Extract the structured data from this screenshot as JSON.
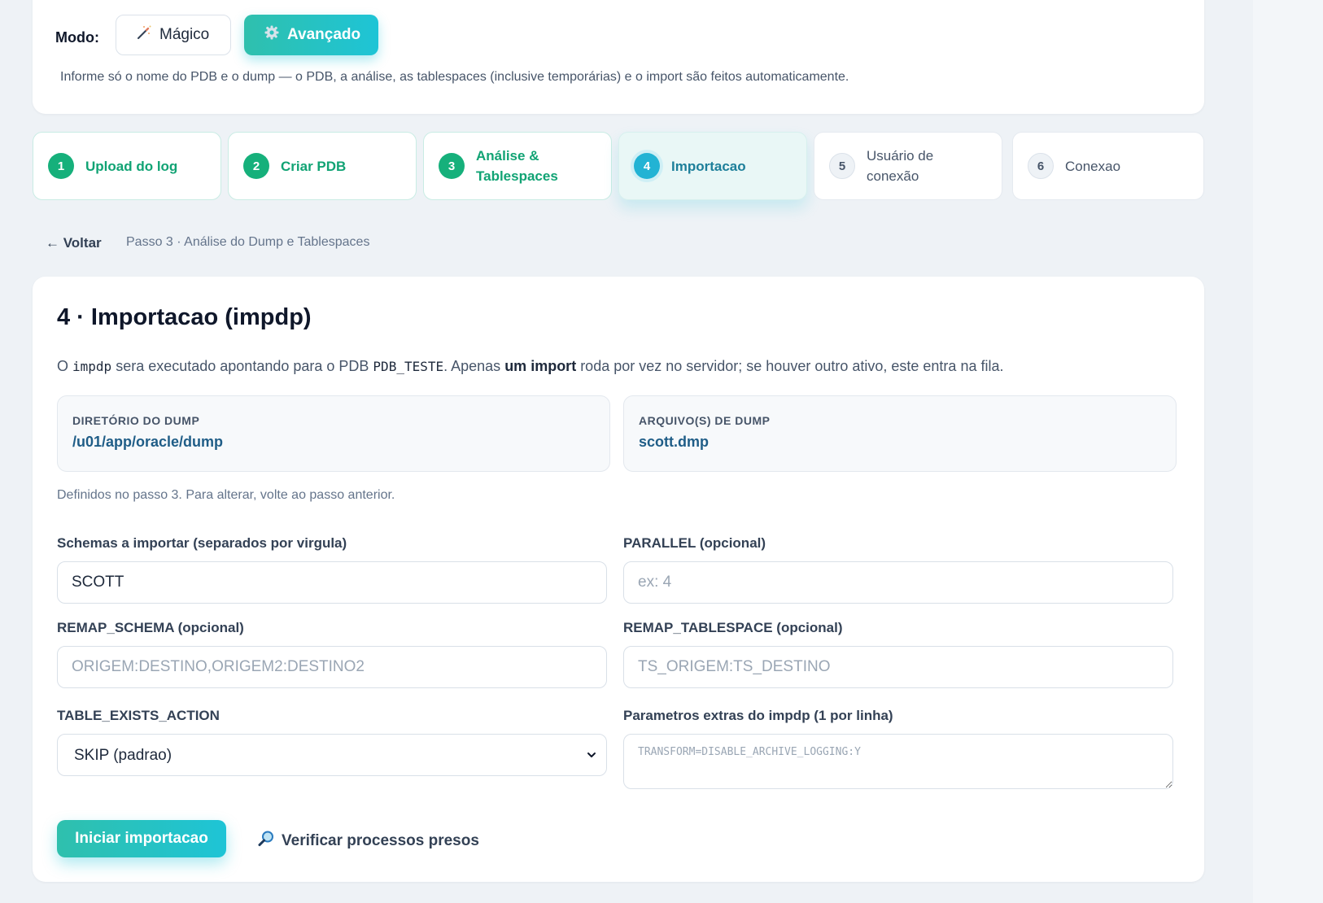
{
  "mode": {
    "label": "Modo:",
    "magic_label": "Mágico",
    "advanced_label": "Avançado",
    "hint": "Informe só o nome do PDB e o dump — o PDB, a análise, as tablespaces (inclusive temporárias) e o import são feitos automaticamente."
  },
  "steps": [
    {
      "num": "1",
      "label_line1": "Upload do log",
      "label_line2": "",
      "state": "done"
    },
    {
      "num": "2",
      "label_line1": "Criar PDB",
      "label_line2": "",
      "state": "done"
    },
    {
      "num": "3",
      "label_line1": "Análise &",
      "label_line2": "Tablespaces",
      "state": "done"
    },
    {
      "num": "4",
      "label_line1": "Importacao",
      "label_line2": "",
      "state": "active"
    },
    {
      "num": "5",
      "label_line1": "Usuário de",
      "label_line2": "conexão",
      "state": "todo"
    },
    {
      "num": "6",
      "label_line1": "Conexao",
      "label_line2": "",
      "state": "todo"
    }
  ],
  "nav": {
    "back_label": "← Voltar",
    "breadcrumb": "Passo 3 · Análise do Dump e Tablespaces"
  },
  "main": {
    "title": "4 · Importacao (impdp)",
    "desc_1": "O ",
    "desc_code_1": "impdp",
    "desc_2": " sera executado apontando para o PDB ",
    "desc_code_2": "PDB_TESTE",
    "desc_3": ". Apenas ",
    "desc_bold": "um import",
    "desc_4": " roda por vez no servidor; se houver outro ativo, este entra na fila.",
    "dump_dir_label": "DIRETÓRIO DO DUMP",
    "dump_dir_value": "/u01/app/oracle/dump",
    "dump_file_label": "ARQUIVO(S) DE DUMP",
    "dump_file_value": "scott.dmp",
    "note": "Definidos no passo 3. Para alterar, volte ao passo anterior.",
    "schemas_label": "Schemas a importar (separados por virgula)",
    "schemas_value": "SCOTT",
    "parallel_label": "PARALLEL (opcional)",
    "parallel_placeholder": "ex: 4",
    "remap_schema_label": "REMAP_SCHEMA (opcional)",
    "remap_schema_placeholder": "ORIGEM:DESTINO,ORIGEM2:DESTINO2",
    "remap_ts_label": "REMAP_TABLESPACE (opcional)",
    "remap_ts_placeholder": "TS_ORIGEM:TS_DESTINO",
    "table_exists_label": "TABLE_EXISTS_ACTION",
    "table_exists_value": "SKIP (padrao)",
    "extras_label": "Parametros extras do impdp (1 por linha)",
    "extras_placeholder": "TRANSFORM=DISABLE_ARCHIVE_LOGGING:Y",
    "start_button": "Iniciar importacao",
    "check_button": "Verificar processos presos"
  },
  "colors": {
    "accent_from": "#2fc0ad",
    "accent_to": "#1ec4d6",
    "step_done": "#16b07b",
    "step_active": "#22b3d4",
    "value_blue": "#1f5d87"
  },
  "icons": {
    "magic": "magic-wand-icon",
    "advanced": "gear-icon",
    "check": "magnifier-icon",
    "select": "chevron-down-icon"
  }
}
